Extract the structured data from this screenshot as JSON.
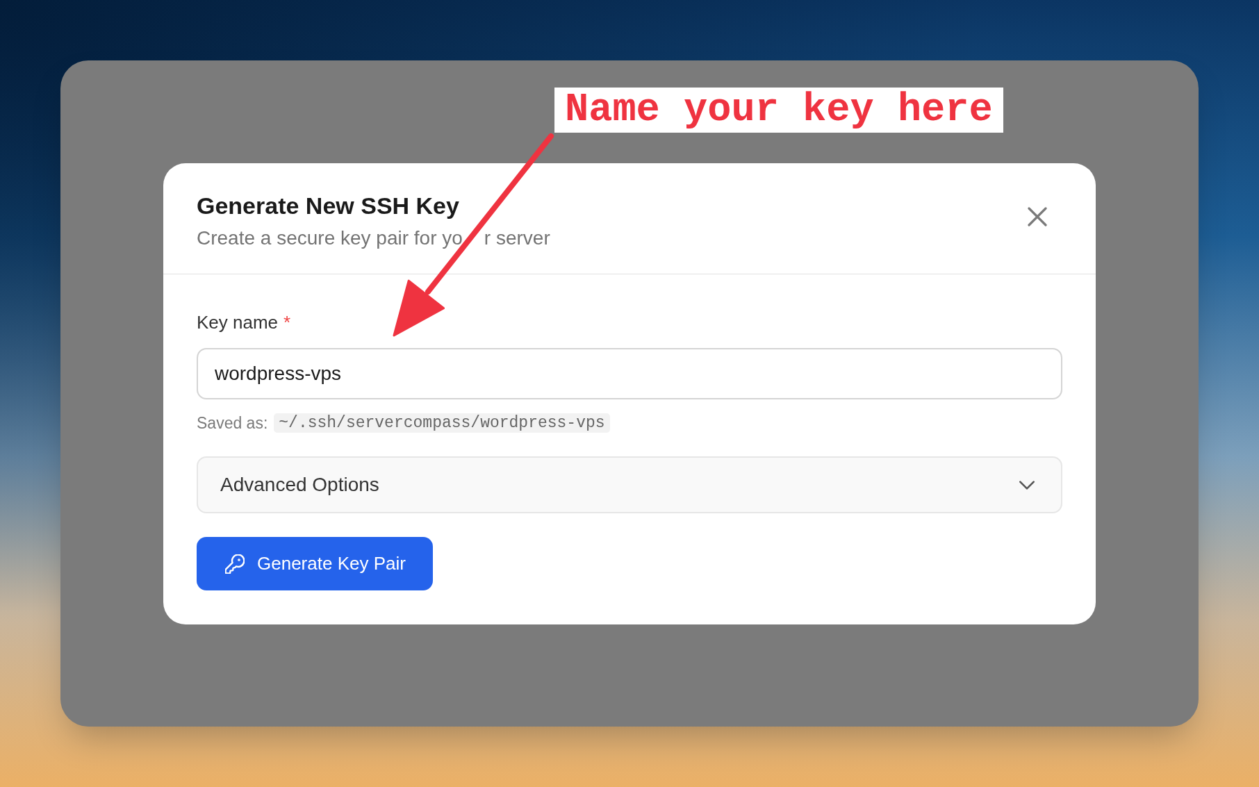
{
  "annotation": {
    "text": "Name your key here"
  },
  "dialog": {
    "title": "Generate New SSH Key",
    "subtitle_parts": [
      "Create a secure key pair for yo",
      "r server"
    ],
    "key_name_field": {
      "label": "Key name",
      "required_mark": "*",
      "value": "wordpress-vps"
    },
    "saved_as": {
      "label": "Saved as:",
      "path": "~/.ssh/servercompass/wordpress-vps"
    },
    "advanced_options": {
      "label": "Advanced Options",
      "expanded": false
    },
    "generate_button": {
      "label": "Generate Key Pair"
    }
  }
}
